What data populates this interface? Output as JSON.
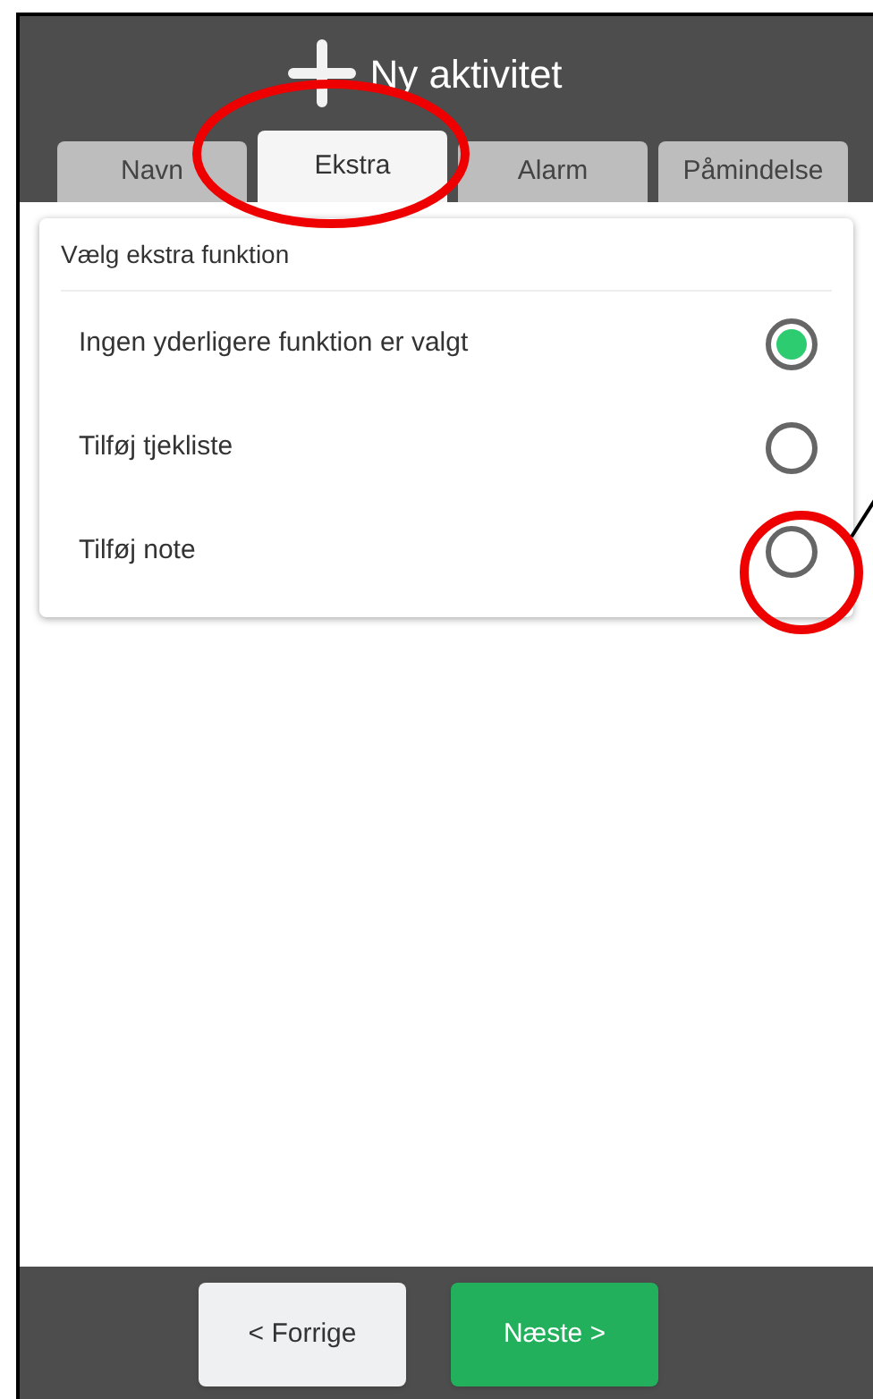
{
  "header": {
    "title": "Ny aktivitet"
  },
  "tabs": [
    {
      "label": "Navn",
      "selected": false
    },
    {
      "label": "Ekstra",
      "selected": true
    },
    {
      "label": "Alarm",
      "selected": false
    },
    {
      "label": "Påmindelse",
      "selected": false
    }
  ],
  "card": {
    "heading": "Vælg ekstra funktion",
    "options": [
      {
        "label": "Ingen yderligere funktion er valgt",
        "selected": true
      },
      {
        "label": "Tilføj tjekliste",
        "selected": false
      },
      {
        "label": "Tilføj note",
        "selected": false
      }
    ]
  },
  "footer": {
    "buttons": [
      {
        "label": "< Forrige",
        "kind": "secondary"
      },
      {
        "label": "Næste >",
        "kind": "primary"
      }
    ]
  }
}
